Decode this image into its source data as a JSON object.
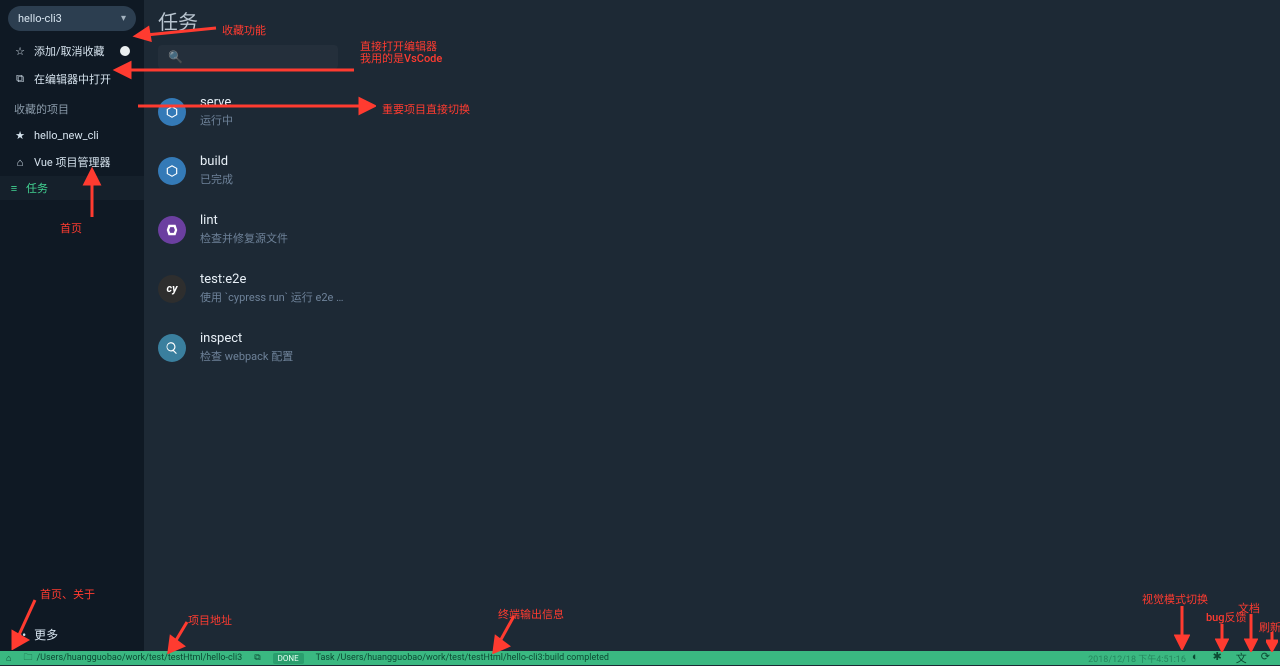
{
  "project": {
    "selected_name": "hello-cli3"
  },
  "sidebar": {
    "toggle_favorite": "添加/取消收藏",
    "open_editor": "在编辑器中打开",
    "section_favorites": "收藏的项目",
    "fav_item": "hello_new_cli",
    "project_manager": "Vue 项目管理器",
    "tasks_tab": "任务",
    "more": "更多"
  },
  "main": {
    "title": "任务",
    "search_placeholder": ""
  },
  "tasks": [
    {
      "name": "serve",
      "desc": "运行中"
    },
    {
      "name": "build",
      "desc": "已完成"
    },
    {
      "name": "lint",
      "desc": "检查并修复源文件"
    },
    {
      "name": "test:e2e",
      "desc": "使用 `cypress run` 运行 e2e …"
    },
    {
      "name": "inspect",
      "desc": "检查 webpack 配置"
    }
  ],
  "status": {
    "path": "/Users/huangguobao/work/test/testHtml/hello-cli3",
    "badge": "DONE",
    "log": "Task /Users/huangguobao/work/test/testHtml/hello-cli3:build completed",
    "timestamp": "2018/12/18 下午4:51:16"
  },
  "annotations": {
    "favorite_feature": "收藏功能",
    "open_editor_note_l1": "直接打开编辑器",
    "open_editor_note_l2": "我用的是VsCode",
    "project_switch": "重要项目直接切换",
    "home_page": "首页",
    "home_about": "首页、关于",
    "project_path": "项目地址",
    "terminal_output": "终端输出信息",
    "theme_switch": "视觉模式切换",
    "bug_report": "bug反馈",
    "docs": "文档",
    "refresh": "刷新"
  }
}
